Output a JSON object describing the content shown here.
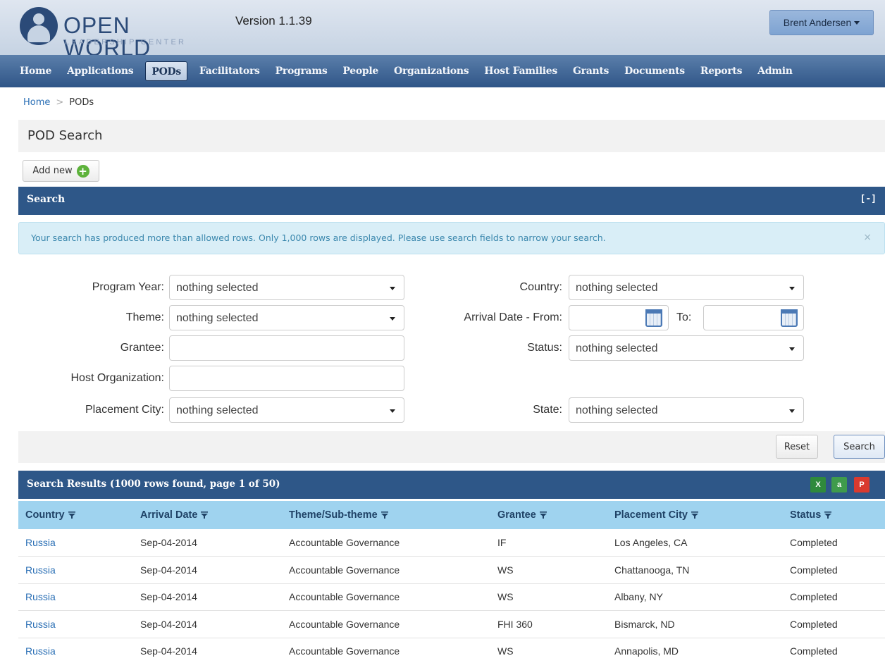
{
  "header": {
    "logo_title": "OPEN WORLD",
    "logo_subtitle": "LEADERSHIP CENTER",
    "version": "Version 1.1.39",
    "user_name": "Brent Andersen"
  },
  "nav": {
    "items": [
      "Home",
      "Applications",
      "PODs",
      "Facilitators",
      "Programs",
      "People",
      "Organizations",
      "Host Families",
      "Grants",
      "Documents",
      "Reports",
      "Admin"
    ],
    "active": "PODs"
  },
  "breadcrumb": {
    "home": "Home",
    "separator": ">",
    "current": "PODs"
  },
  "page_title": "POD Search",
  "add_button": "Add new",
  "search_panel": {
    "title": "Search",
    "collapse_label": "[-]",
    "alert": "Your search has produced more than allowed rows. Only 1,000 rows are displayed. Please use search fields to narrow your search.",
    "alert_close": "×",
    "fields": {
      "program_year": {
        "label": "Program Year:",
        "value": "nothing selected"
      },
      "theme": {
        "label": "Theme:",
        "value": "nothing selected"
      },
      "grantee": {
        "label": "Grantee:",
        "value": ""
      },
      "host_org": {
        "label": "Host Organization:",
        "value": ""
      },
      "placement_city": {
        "label": "Placement City:",
        "value": "nothing selected"
      },
      "country": {
        "label": "Country:",
        "value": "nothing selected"
      },
      "arrival_from": {
        "label": "Arrival Date - From:",
        "value": ""
      },
      "arrival_to": {
        "label": "To:",
        "value": ""
      },
      "status": {
        "label": "Status:",
        "value": "nothing selected"
      },
      "state": {
        "label": "State:",
        "value": "nothing selected"
      }
    },
    "reset_label": "Reset",
    "search_label": "Search"
  },
  "results": {
    "title": "Search Results  (1000 rows found, page 1 of 50)",
    "export_icons": [
      "excel-icon",
      "csv-icon",
      "pdf-icon"
    ],
    "columns": [
      "Country",
      "Arrival Date",
      "Theme/Sub-theme",
      "Grantee",
      "Placement City",
      "Status"
    ],
    "rows": [
      [
        "Russia",
        "Sep-04-2014",
        "Accountable Governance",
        "IF",
        "Los Angeles, CA",
        "Completed"
      ],
      [
        "Russia",
        "Sep-04-2014",
        "Accountable Governance",
        "WS",
        "Chattanooga, TN",
        "Completed"
      ],
      [
        "Russia",
        "Sep-04-2014",
        "Accountable Governance",
        "WS",
        "Albany, NY",
        "Completed"
      ],
      [
        "Russia",
        "Sep-04-2014",
        "Accountable Governance",
        "FHI 360",
        "Bismarck, ND",
        "Completed"
      ],
      [
        "Russia",
        "Sep-04-2014",
        "Accountable Governance",
        "WS",
        "Annapolis, MD",
        "Completed"
      ]
    ]
  },
  "colors": {
    "nav_bg": "#2f5587",
    "panel_header": "#2e5788",
    "table_header": "#9fd3ef",
    "link": "#2a6fb5",
    "alert_bg": "#d9eef7"
  }
}
